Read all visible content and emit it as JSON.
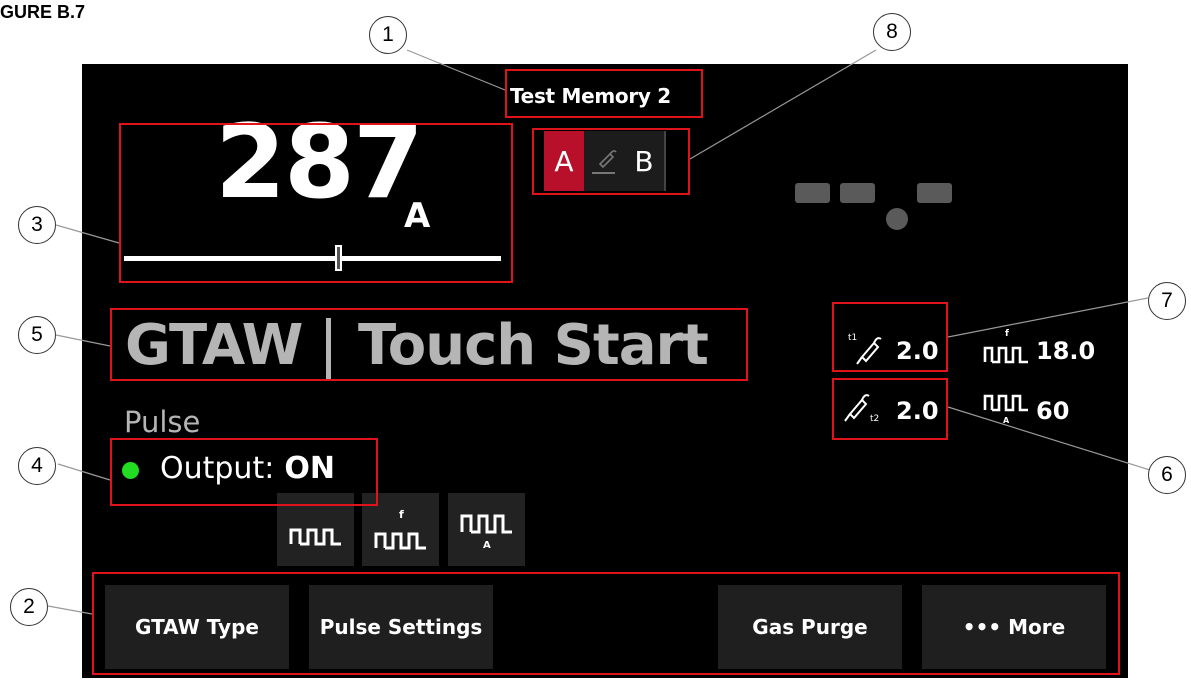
{
  "figure_label": "GURE B.7",
  "memory_title": "Test Memory 2",
  "amperage": {
    "value": "287",
    "unit": "A",
    "level": 0.57
  },
  "ab_selector": {
    "a": "A",
    "b": "B",
    "active": "A"
  },
  "process": {
    "type": "GTAW",
    "start": "Touch Start"
  },
  "mode": "Pulse",
  "output": {
    "label": "Output:",
    "value": "ON",
    "status_color": "#22dd22"
  },
  "pulse_buttons": [
    {
      "icon": "pulse-icon"
    },
    {
      "icon": "pulse-frequency-icon"
    },
    {
      "icon": "pulse-amplitude-icon"
    }
  ],
  "params": {
    "t1": {
      "value": "2.0",
      "icon": "preflow-t1-icon"
    },
    "t2": {
      "value": "2.0",
      "icon": "postflow-t2-icon"
    },
    "frequency": {
      "value": "18.0",
      "icon": "pulse-frequency-icon"
    },
    "amplitude": {
      "value": "60",
      "icon": "pulse-amplitude-icon"
    }
  },
  "softkeys": [
    "GTAW Type",
    "Pulse Settings",
    "Gas Purge",
    "••• More"
  ],
  "callouts": [
    "1",
    "2",
    "3",
    "4",
    "5",
    "6",
    "7",
    "8"
  ],
  "colors": {
    "highlight_box": "#e0121a",
    "ab_active": "#b8102a",
    "process_text": "#b5b5b5"
  }
}
